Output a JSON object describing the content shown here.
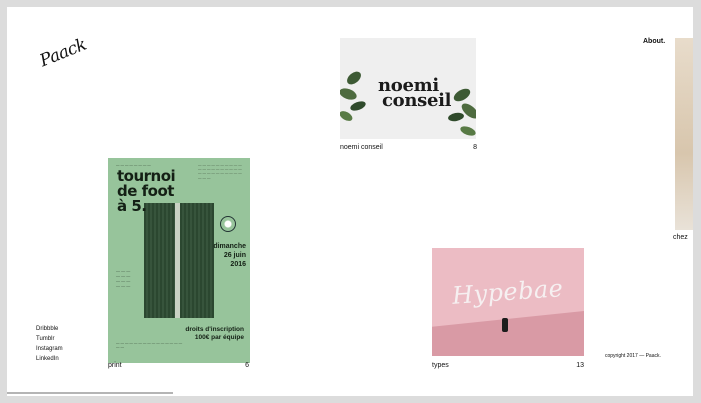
{
  "brand": {
    "logo": "Paack"
  },
  "nav": {
    "about": "About."
  },
  "projects": [
    {
      "label": "noemi conseil",
      "number": "8",
      "image_title_line1": "noemi",
      "image_title_line2": "conseil"
    },
    {
      "label": "print",
      "number": "6"
    },
    {
      "label": "types",
      "number": "13",
      "image_title": "Hypebae"
    }
  ],
  "poster": {
    "title_lines": [
      "tournoi",
      "de foot",
      "à 5."
    ],
    "date_lines": [
      "dimanche",
      "26 juin",
      "2016"
    ],
    "fee_lines": [
      "droits d'inscription",
      "100€ par équipe"
    ]
  },
  "partial_card": {
    "label": "chez"
  },
  "social": [
    "Dribbble",
    "Tumblr",
    "Instagram",
    "LinkedIn"
  ],
  "footer": {
    "copyright": "copyright 2017 — Paack."
  },
  "colors": {
    "poster_green": "#97c49b",
    "hype_pink": "#ecbcc4",
    "page_bg": "#ffffff"
  }
}
